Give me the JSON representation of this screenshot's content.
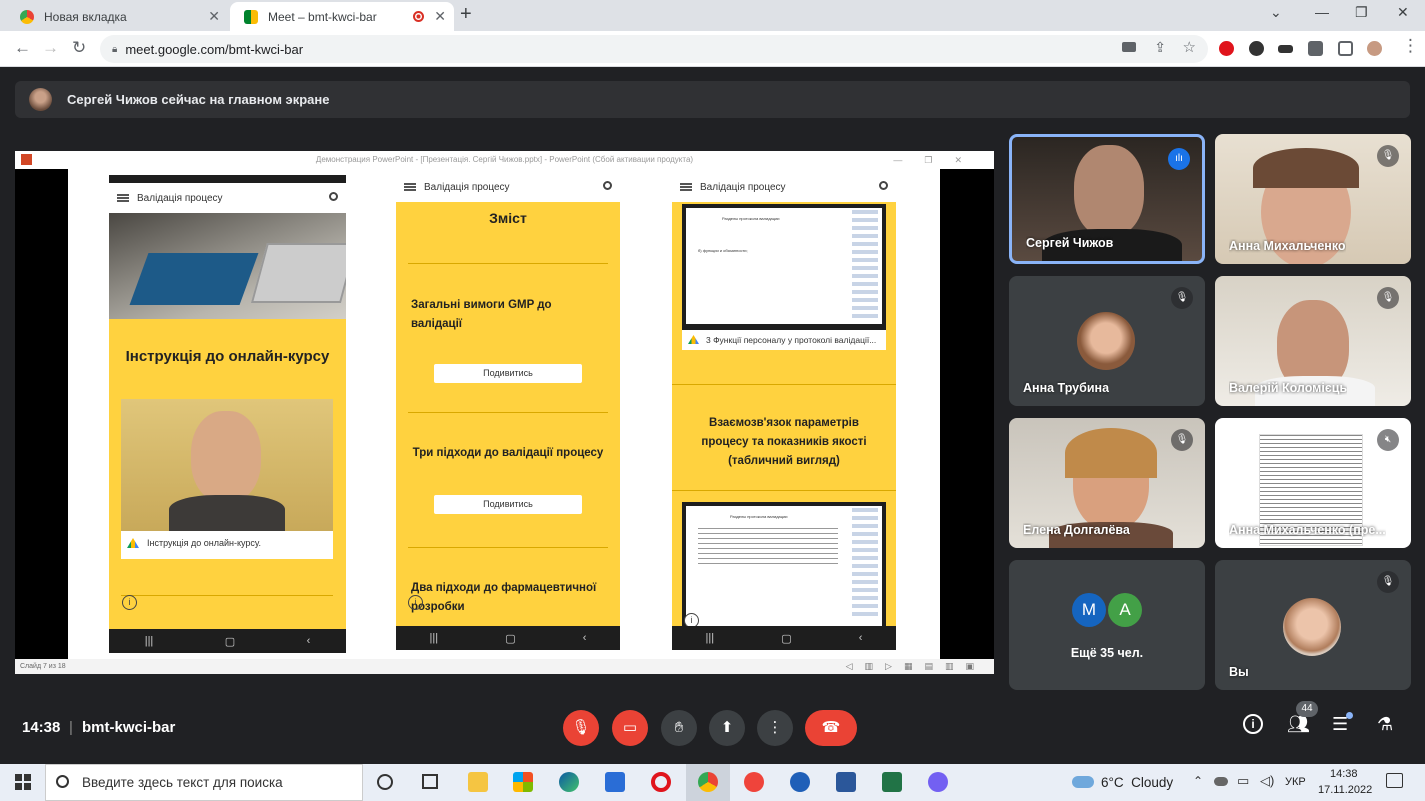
{
  "browser": {
    "tabs": [
      {
        "title": "Новая вкладка"
      },
      {
        "title": "Meet – bmt-kwci-bar"
      }
    ],
    "url": "meet.google.com/bmt-kwci-bar"
  },
  "banner": {
    "text": "Сергей Чижов сейчас на главном экране"
  },
  "presentation": {
    "window_title": "Демонстрация PowerPoint - [Презентація. Сергій Чижов.pptx] - PowerPoint (Сбой активации продукта)",
    "status": "Слайд 7 из 18",
    "phones": [
      {
        "header": "Валідація процесу",
        "title": "Інструкція до онлайн-курсу",
        "video_caption": "Інструкція до онлайн-курсу."
      },
      {
        "header": "Валідація процесу",
        "heading": "Зміст",
        "items": [
          {
            "text": "Загальні вимоги GMP до валідації",
            "button": "Подивитись"
          },
          {
            "text": "Три підходи до валідації процесу",
            "button": "Подивитись"
          },
          {
            "text": "Два підходи до фармацевтичної розробки"
          }
        ]
      },
      {
        "header": "Валідація процесу",
        "doc_caption": "3 Функції персоналу у протоколі валідації...",
        "mini_title": "Разделы протокола валидации",
        "mini_line": "б) функции и обязанности;",
        "mini_title2": "Разделы протокола валидации",
        "text": "Взаємозв'язок параметрів процесу та показників якості (табличний вигляд)"
      }
    ]
  },
  "participants": [
    {
      "name": "Сергей Чижов",
      "speaking": true
    },
    {
      "name": "Анна Михальченко",
      "muted": true
    },
    {
      "name": "Анна Трубина",
      "muted": true
    },
    {
      "name": "Валерій Коломієць",
      "muted": true
    },
    {
      "name": "Елена Долгалёва",
      "muted": true
    },
    {
      "name": "Анна Михальченко (пре...",
      "muted": true
    },
    {
      "more": "Ещё 35 чел.",
      "initials": [
        "М",
        "А"
      ]
    },
    {
      "name": "Вы",
      "muted": true
    }
  ],
  "controls": {
    "time": "14:38",
    "meeting_code": "bmt-kwci-bar",
    "people_count": "44"
  },
  "taskbar": {
    "search_placeholder": "Введите здесь текст для поиска",
    "weather": "6°C  Cloudy",
    "lang": "УКР",
    "time": "14:38",
    "date": "17.11.2022"
  },
  "colors": {
    "meet_bg": "#202124",
    "end_call": "#ea4335",
    "phone_yellow": "#ffd23f",
    "speaker_border": "#8ab4f8"
  }
}
